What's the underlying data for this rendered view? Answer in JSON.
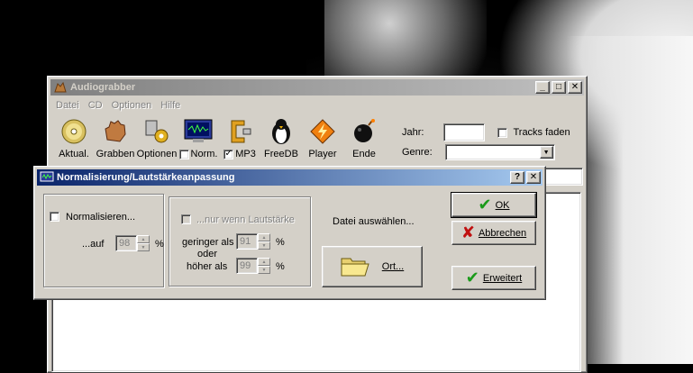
{
  "main_window": {
    "title": "Audiograbber",
    "menu": [
      "Datei",
      "CD",
      "Optionen",
      "Hilfe"
    ],
    "toolbar": [
      {
        "label": "Aktual.",
        "icon": "cd-icon"
      },
      {
        "label": "Grabben",
        "icon": "hand-icon"
      },
      {
        "label": "Optionen",
        "icon": "gears-icon"
      },
      {
        "label": "Norm.",
        "icon": "monitor-icon",
        "checked": false
      },
      {
        "label": "MP3",
        "icon": "clamp-icon",
        "checked": true
      },
      {
        "label": "FreeDB",
        "icon": "penguin-icon"
      },
      {
        "label": "Player",
        "icon": "winamp-icon"
      },
      {
        "label": "Ende",
        "icon": "bomb-icon"
      }
    ],
    "jahr_label": "Jahr:",
    "jahr_value": "",
    "tracks_faden_label": "Tracks faden",
    "genre_label": "Genre:",
    "genre_value": ""
  },
  "dialog": {
    "title": "Normalisierung/Lautstärkeanpassung",
    "normalize_label": "Normalisieren...",
    "auf_label": "...auf",
    "auf_value": "98",
    "percent": "%",
    "only_if_label": "...nur wenn Lautstärke",
    "lower_than_label": "geringer als",
    "lower_value": "91",
    "or_label": "oder",
    "higher_than_label": "höher als",
    "higher_value": "99",
    "file_select_label": "Datei auswählen...",
    "ort_label": "Ort...",
    "ok_label": "OK",
    "cancel_label": "Abbrechen",
    "advanced_label": "Erweitert"
  },
  "colors": {
    "face": "#d4d0c8",
    "active_title": "#0a246a",
    "inactive_title": "#808080"
  }
}
